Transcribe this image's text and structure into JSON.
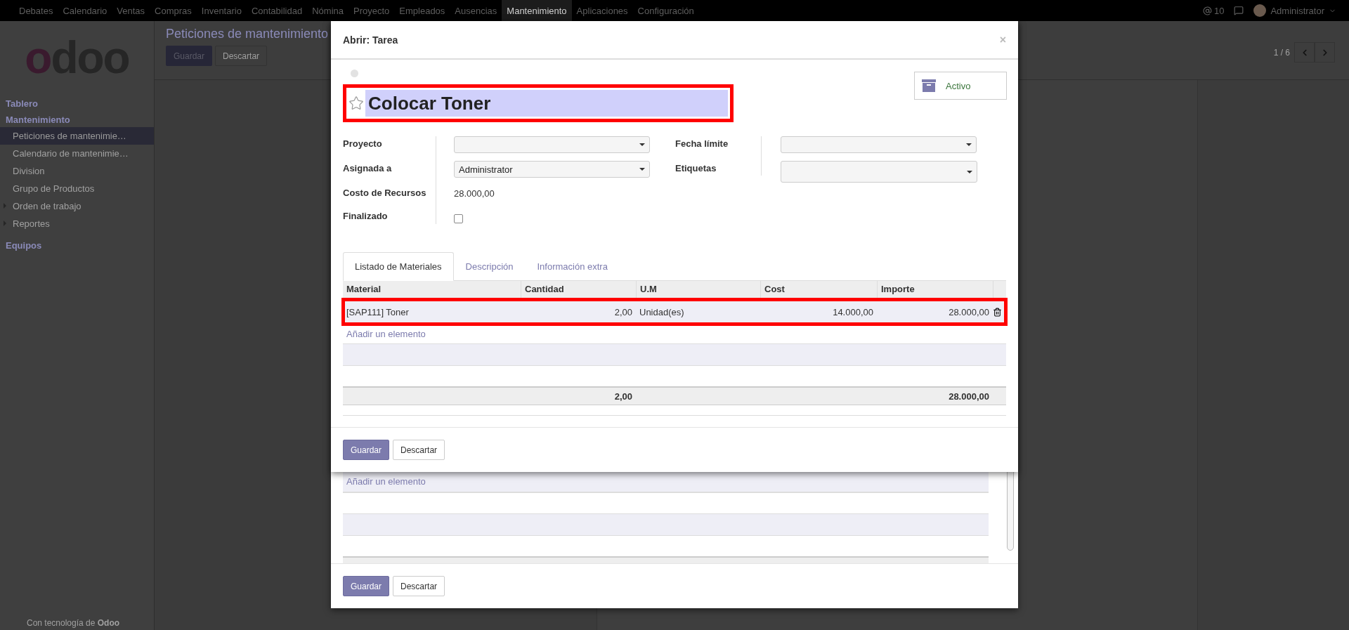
{
  "nav": {
    "menus": [
      {
        "label": "Debates",
        "selected": false
      },
      {
        "label": "Calendario",
        "selected": false
      },
      {
        "label": "Ventas",
        "selected": false
      },
      {
        "label": "Compras",
        "selected": false
      },
      {
        "label": "Inventario",
        "selected": false
      },
      {
        "label": "Contabilidad",
        "selected": false
      },
      {
        "label": "Nómina",
        "selected": false
      },
      {
        "label": "Proyecto",
        "selected": false
      },
      {
        "label": "Empleados",
        "selected": false
      },
      {
        "label": "Ausencias",
        "selected": false
      },
      {
        "label": "Mantenimiento",
        "selected": true
      },
      {
        "label": "Aplicaciones",
        "selected": false
      },
      {
        "label": "Configuración",
        "selected": false
      }
    ],
    "messages_count": "10",
    "user": "Administrator"
  },
  "sidebar": {
    "logo": "odoo",
    "sections": [
      {
        "title": "Tablero"
      },
      {
        "title": "Mantenimiento",
        "items": [
          {
            "label": "Peticiones de mantenimie…",
            "selected": true,
            "expandable": false
          },
          {
            "label": "Calendario de mantenimie…",
            "selected": false,
            "expandable": false
          },
          {
            "label": "Division",
            "selected": false,
            "expandable": false
          },
          {
            "label": "Grupo de Productos",
            "selected": false,
            "expandable": false
          },
          {
            "label": "Orden de trabajo",
            "selected": false,
            "expandable": true
          },
          {
            "label": "Reportes",
            "selected": false,
            "expandable": true
          }
        ]
      },
      {
        "title": "Equipos"
      }
    ],
    "footer": "Con tecnología de **Odoo**"
  },
  "page": {
    "title": "Peticiones de mantenimiento",
    "buttons": [
      "Guardar",
      "Descartar"
    ],
    "pager": "1 / 6"
  },
  "back_dialog": {
    "add_line": "Añadir un elemento",
    "buttons": [
      "Guardar",
      "Descartar"
    ]
  },
  "dialog": {
    "title": "Abrir: Tarea",
    "close": "×",
    "status_button": "Activo",
    "task": {
      "name": "Colocar Toner",
      "starred": false,
      "highlighted": true
    },
    "fields_left": [
      {
        "label": "Proyecto",
        "kind": "select"
      },
      {
        "label": "Asignada a",
        "kind": "select",
        "value": "Administrator"
      },
      {
        "label": "Costo de Recursos",
        "kind": "text",
        "value": "28.000,00"
      },
      {
        "label": "Finalizado",
        "kind": "checkbox",
        "checked": false
      }
    ],
    "fields_right": [
      {
        "label": "Fecha límite",
        "kind": "select"
      },
      {
        "label": "Etiquetas",
        "kind": "tags"
      }
    ],
    "tabs": [
      {
        "label": "Listado de Materiales",
        "selected": true
      },
      {
        "label": "Descripción",
        "selected": false
      },
      {
        "label": "Información extra",
        "selected": false
      }
    ],
    "table": {
      "columns": [
        "Material",
        "Cantidad",
        "U.M",
        "Cost",
        "Importe"
      ],
      "rows": [
        {
          "cells": [
            "[SAP111] Toner",
            "2,00",
            "Unidad(es)",
            "14.000,00",
            "28.000,00"
          ],
          "highlighted": true
        }
      ],
      "add_line": "Añadir un elemento",
      "totals": {
        "quantity": "2,00",
        "amount": "28.000,00"
      }
    },
    "buttons": [
      "Guardar",
      "Descartar"
    ]
  }
}
